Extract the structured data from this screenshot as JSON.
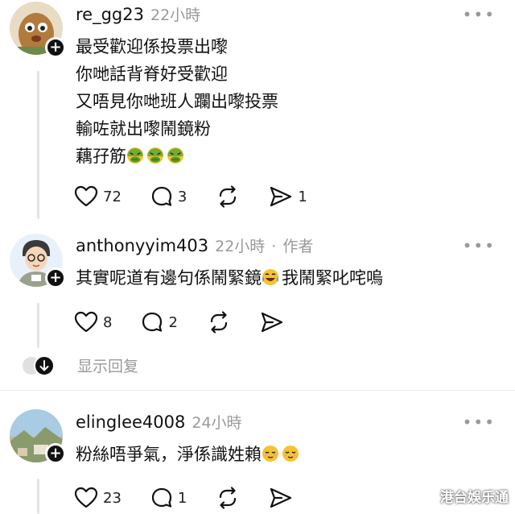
{
  "posts": [
    {
      "username": "re_gg23",
      "time": "22小時",
      "role": "",
      "lines": [
        "最受歡迎係投票出嚟",
        "你哋話背脊好受歡迎",
        "又唔見你哋班人躝出嚟投票",
        "輸咗就出嚟鬧鏡粉",
        "藕孖筋"
      ],
      "emoji_count": 3,
      "likes": "72",
      "comments": "3",
      "shares": "1",
      "avatar_icon": "potato-character-avatar"
    },
    {
      "username": "anthonyyim403",
      "time": "22小時",
      "role": "作者",
      "text_before": "其實呢道有邊句係鬧緊鏡",
      "text_after": "我鬧緊叱咤嗚",
      "likes": "8",
      "comments": "2",
      "avatar_icon": "cartoon-person-avatar"
    },
    {
      "username": "elinglee4008",
      "time": "24小時",
      "role": "",
      "text": "粉絲唔爭氣，淨係識姓賴",
      "likes": "23",
      "comments": "1",
      "avatar_icon": "landscape-photo-avatar"
    }
  ],
  "show_replies_label": "显示回复",
  "more_glyph": "•••",
  "meta_separator": "·",
  "watermark": "港台娛乐通",
  "colors": {
    "text": "#111111",
    "muted": "#999999",
    "thread_line": "#e4e4e4",
    "emoji_green": "#5aa832",
    "emoji_yellow": "#f6c232"
  }
}
